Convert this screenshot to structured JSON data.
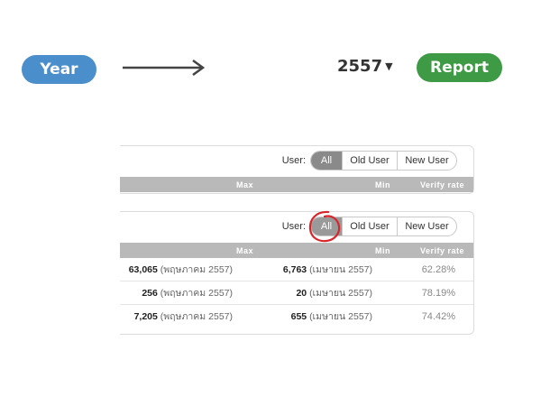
{
  "buttons": {
    "year_label": "Year",
    "report_label": "Report"
  },
  "year_select": {
    "value": "2557",
    "caret": "▼"
  },
  "panel_top": {
    "user_label": "User:",
    "segments": [
      "All",
      "Old User",
      "New User"
    ],
    "columns": [
      "Max",
      "Min",
      "Verify rate"
    ]
  },
  "panel_bottom": {
    "user_label": "User:",
    "segments": [
      "All",
      "Old User",
      "New User"
    ],
    "columns": [
      "Max",
      "Min",
      "Verify rate"
    ],
    "rows": [
      {
        "max_value": "63,065",
        "max_date": "(พฤษภาคม 2557)",
        "min_value": "6,763",
        "min_date": "(เมษายน 2557)",
        "rate": "62.28%"
      },
      {
        "max_value": "256",
        "max_date": "(พฤษภาคม 2557)",
        "min_value": "20",
        "min_date": "(เมษายน 2557)",
        "rate": "78.19%"
      },
      {
        "max_value": "7,205",
        "max_date": "(พฤษภาคม 2557)",
        "min_value": "655",
        "min_date": "(เมษายน 2557)",
        "rate": "74.42%"
      }
    ]
  },
  "annotation": {
    "circle_color": "#d9262c"
  },
  "colors": {
    "year_blue": "#4a8fcb",
    "report_green": "#3e9a45",
    "header_gray": "#b9b9b9"
  }
}
